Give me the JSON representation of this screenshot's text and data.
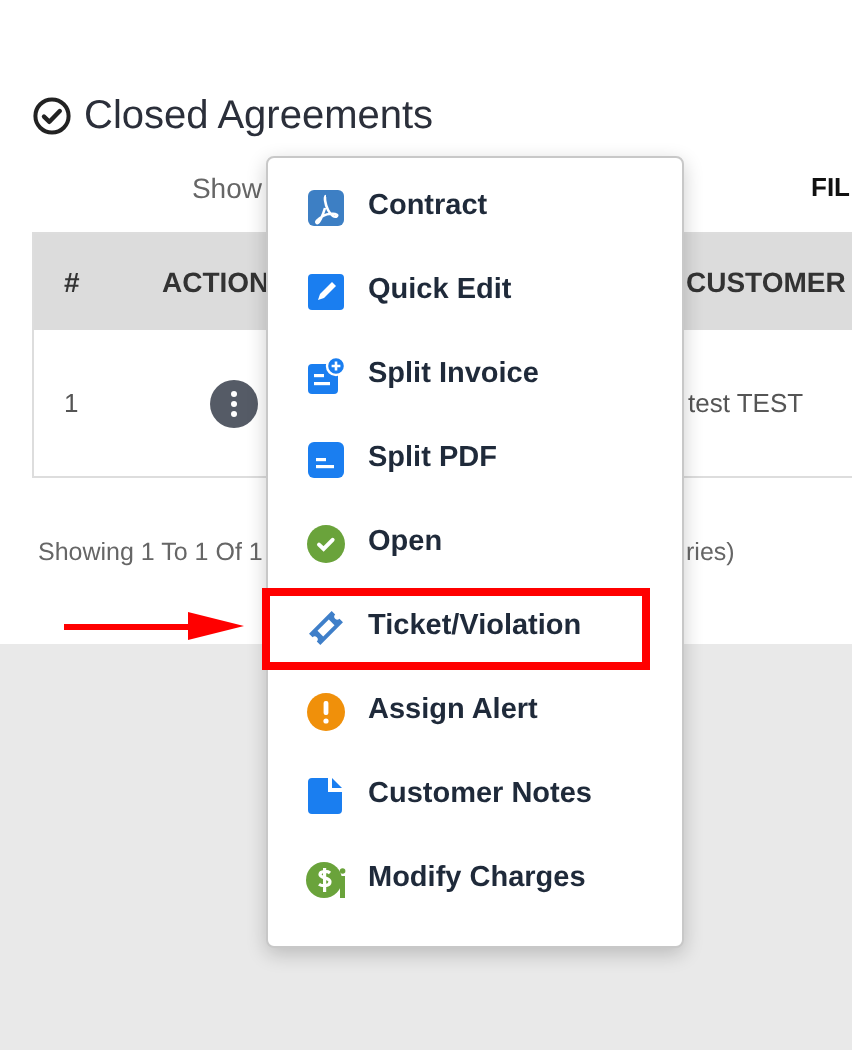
{
  "page": {
    "title": "Closed Agreements",
    "show_label": "Show",
    "filter_label": "FIL"
  },
  "table": {
    "columns": [
      "#",
      "ACTION",
      "CUSTOMER"
    ],
    "rows": [
      {
        "number": "1",
        "customer": "test TEST",
        "menu_open": true
      }
    ],
    "footer_left": "Showing 1 To 1 Of 1",
    "footer_right": "ries)"
  },
  "menu": {
    "items": [
      {
        "label": "Contract",
        "highlighted": false
      },
      {
        "label": "Quick Edit",
        "highlighted": false
      },
      {
        "label": "Split Invoice",
        "highlighted": false
      },
      {
        "label": "Split PDF",
        "highlighted": false
      },
      {
        "label": "Open",
        "highlighted": false
      },
      {
        "label": "Ticket/Violation",
        "highlighted": true
      },
      {
        "label": "Assign Alert",
        "highlighted": false
      },
      {
        "label": "Customer Notes",
        "highlighted": false
      },
      {
        "label": "Modify Charges",
        "highlighted": false
      }
    ]
  }
}
